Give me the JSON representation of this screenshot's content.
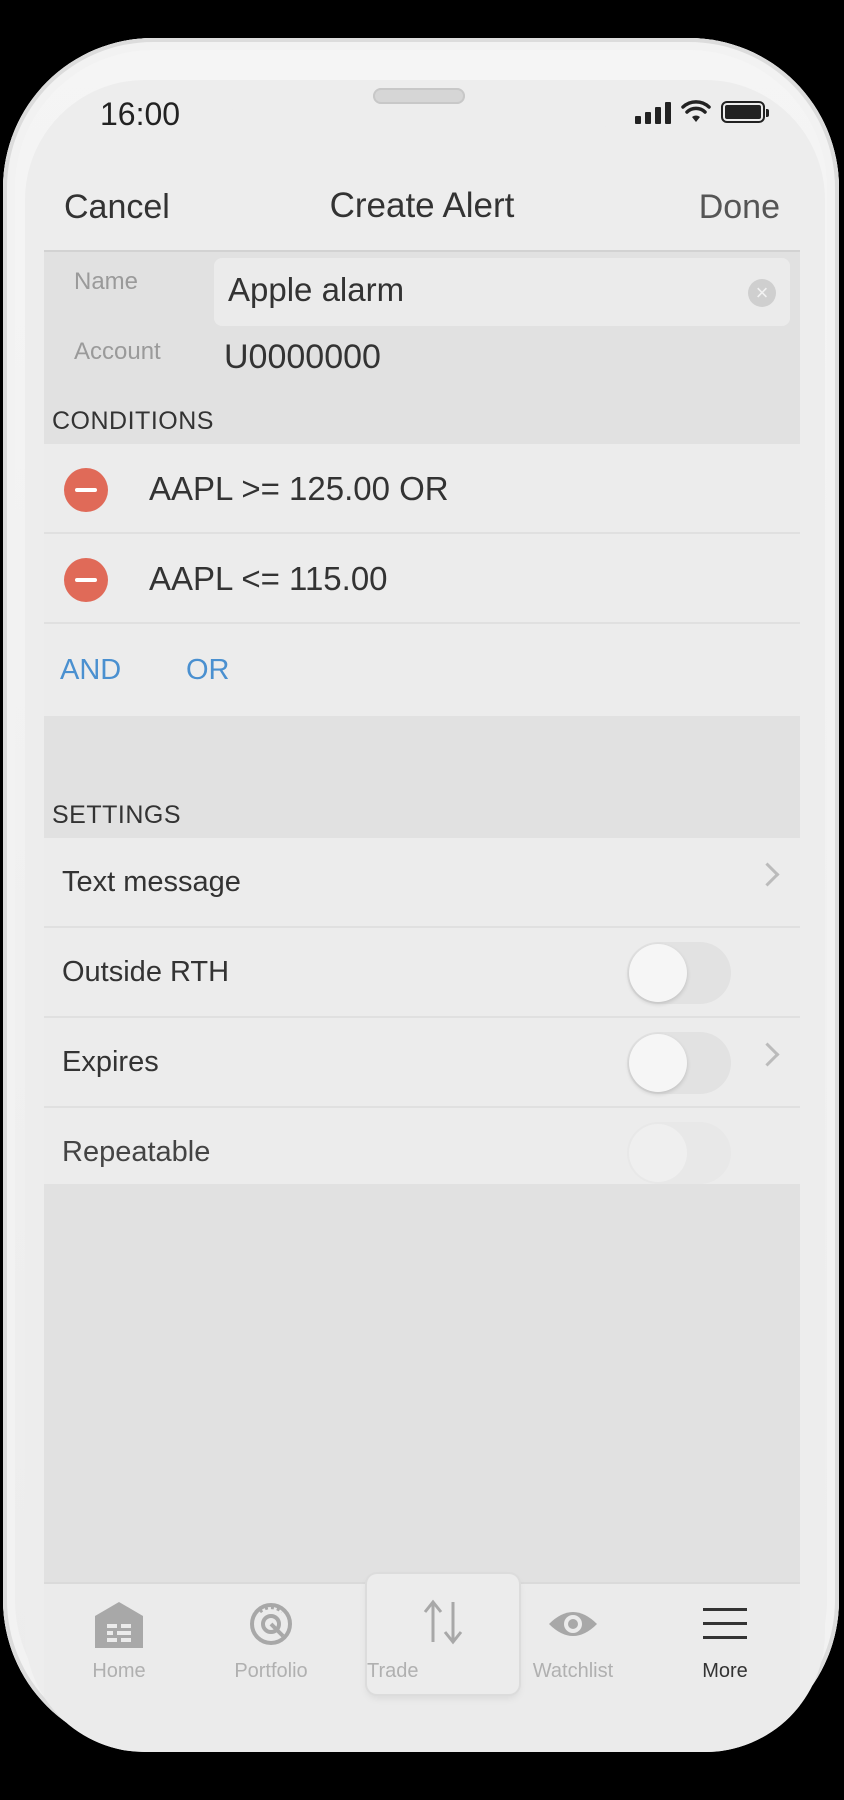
{
  "status_bar": {
    "time": "16:00"
  },
  "nav": {
    "cancel": "Cancel",
    "title": "Create Alert",
    "done": "Done"
  },
  "form": {
    "name_label": "Name",
    "name_value": "Apple alarm",
    "account_label": "Account",
    "account_value": "U0000000"
  },
  "conditions": {
    "header": "CONDITIONS",
    "items": [
      "AAPL >= 125.00 OR",
      "AAPL <= 115.00"
    ],
    "and_label": "AND",
    "or_label": "OR"
  },
  "settings": {
    "header": "SETTINGS",
    "text_message": "Text message",
    "outside_rth": "Outside RTH",
    "expires": "Expires",
    "repeatable": "Repeatable"
  },
  "tabbar": {
    "home": "Home",
    "portfolio": "Portfolio",
    "trade": "Trade",
    "watchlist": "Watchlist",
    "more": "More"
  },
  "colors": {
    "accent_blue": "#4a90d0",
    "remove_red": "#e06a58"
  }
}
